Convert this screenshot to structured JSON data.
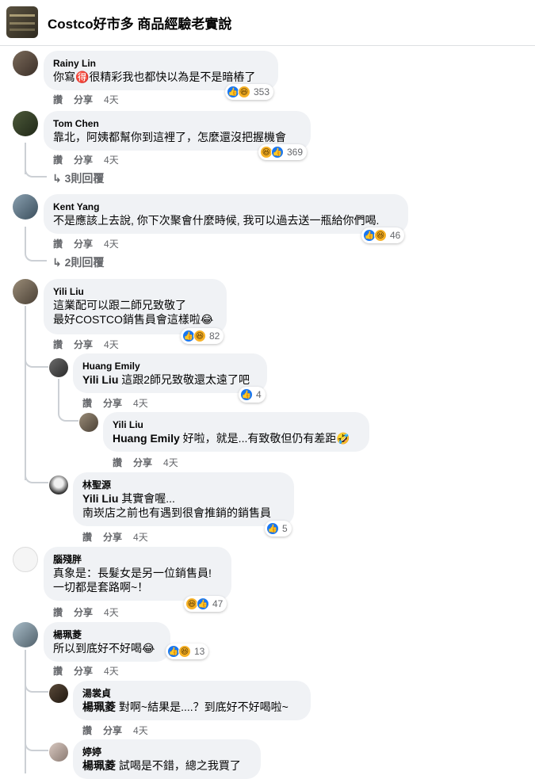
{
  "group": {
    "title": "Costco好市多 商品經驗老實說"
  },
  "labels": {
    "like": "讚",
    "share": "分享"
  },
  "comments": [
    {
      "name": "Rainy Lin",
      "text": "你寫🉐很精彩我也都快以為是不是暗樁了",
      "time": "4天",
      "count": "353"
    },
    {
      "name": "Tom Chen",
      "text": "靠北，阿姨都幫你到這裡了，怎麼還沒把握機會",
      "time": "4天",
      "count": "369",
      "replies": "3則回覆"
    },
    {
      "name": "Kent Yang",
      "text": "不是應該上去說, 你下次聚會什麼時候, 我可以過去送一瓶給你們喝.",
      "time": "4天",
      "count": "46",
      "replies": "2則回覆"
    },
    {
      "name": "Yili Liu",
      "line1": "這業配可以跟二師兄致敬了",
      "line2": "最好COSTCO銷售員會這樣啦😂",
      "time": "4天",
      "count": "82"
    },
    {
      "name": "Huang Emily",
      "mention": "Yili Liu",
      "text": " 這跟2師兄致敬還太遠了吧",
      "time": "4天",
      "count": "4"
    },
    {
      "name": "Yili Liu",
      "mention": "Huang Emily",
      "text": " 好啦，就是...有致敬但仍有差距🤣",
      "time": "4天"
    },
    {
      "name": "林聖源",
      "mention": "Yili Liu",
      "text": " 其實會喔...",
      "line2": "南崁店之前也有遇到很會推銷的銷售員",
      "time": "4天",
      "count": "5"
    },
    {
      "name": "腦殘胖",
      "line1": "真象是：長髮女是另一位銷售員!",
      "line2": "一切都是套路啊~！",
      "time": "4天",
      "count": "47"
    },
    {
      "name": "楊珮菱",
      "text": "所以到底好不好喝😂",
      "time": "4天",
      "count": "13"
    },
    {
      "name": "湯裳貞",
      "mention": "楊珮菱",
      "text": " 對啊~結果是....？到底好不好喝啦~",
      "time": "4天"
    },
    {
      "name": "婷婷",
      "mention": "楊珮菱",
      "text": " 試喝是不錯，總之我買了"
    }
  ]
}
